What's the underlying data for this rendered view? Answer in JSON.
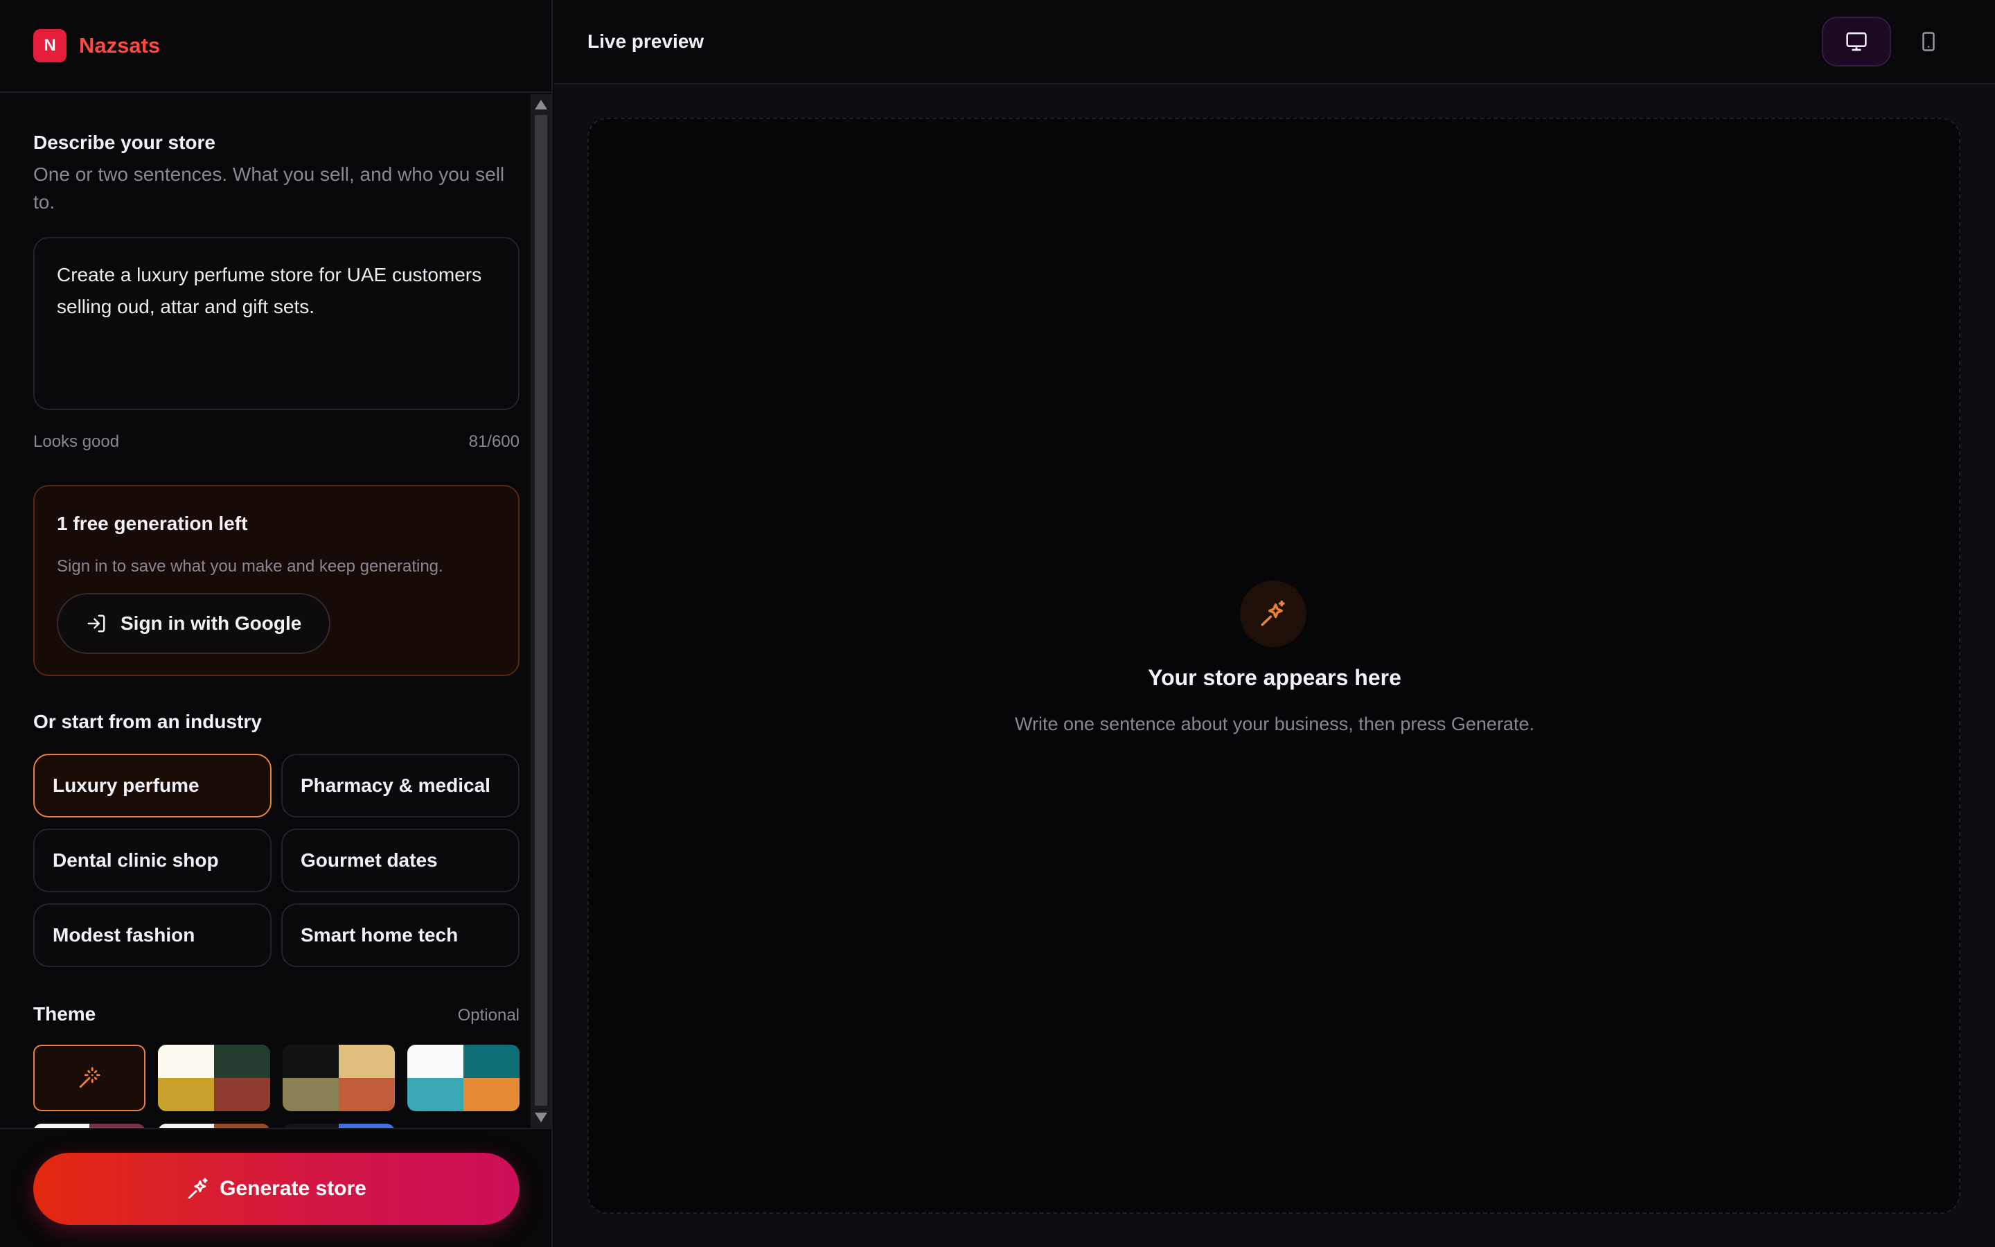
{
  "brand": {
    "logo_letter": "N",
    "name": "Nazsats"
  },
  "describe": {
    "title": "Describe your store",
    "subtitle": "One or two sentences. What you sell, and who you sell to.",
    "prompt_value": "Create a luxury perfume store for UAE customers selling oud, attar and gift sets.",
    "status": "Looks good",
    "char_count": "81/600"
  },
  "free_card": {
    "title": "1 free generation left",
    "subtitle": "Sign in to save what you make and keep generating.",
    "sign_in_label": "Sign in with Google"
  },
  "industry": {
    "title": "Or start from an industry",
    "items": [
      {
        "label": "Luxury perfume",
        "active": true
      },
      {
        "label": "Pharmacy & medical",
        "active": false
      },
      {
        "label": "Dental clinic shop",
        "active": false
      },
      {
        "label": "Gourmet dates",
        "active": false
      },
      {
        "label": "Modest fashion",
        "active": false
      },
      {
        "label": "Smart home tech",
        "active": false
      }
    ]
  },
  "theme": {
    "title": "Theme",
    "optional_label": "Optional",
    "swatches": [
      [
        "#fdfbf1",
        "#233d2e",
        "#c9a22b",
        "#8f3b2f"
      ],
      [
        "#111214",
        "#e0bf7c",
        "#8b8055",
        "#c25d3c"
      ],
      [
        "#fafcfd",
        "#0e6f78",
        "#3aa8b3",
        "#e58a35"
      ]
    ],
    "partial_swatches": [
      [
        "#f4f4f4",
        "#7a3046"
      ],
      [
        "#f4f4f4",
        "#9a4a20"
      ],
      [
        "#12141a",
        "#3f72e8"
      ]
    ]
  },
  "generate_label": "Generate store",
  "preview": {
    "title": "Live preview",
    "empty_title": "Your store appears here",
    "empty_subtitle": "Write one sentence about your business, then press Generate."
  },
  "colors": {
    "accent": "#e8813e",
    "brand": "#e51e3c",
    "cta_start": "#e3290f",
    "cta_end": "#cc0f59"
  }
}
